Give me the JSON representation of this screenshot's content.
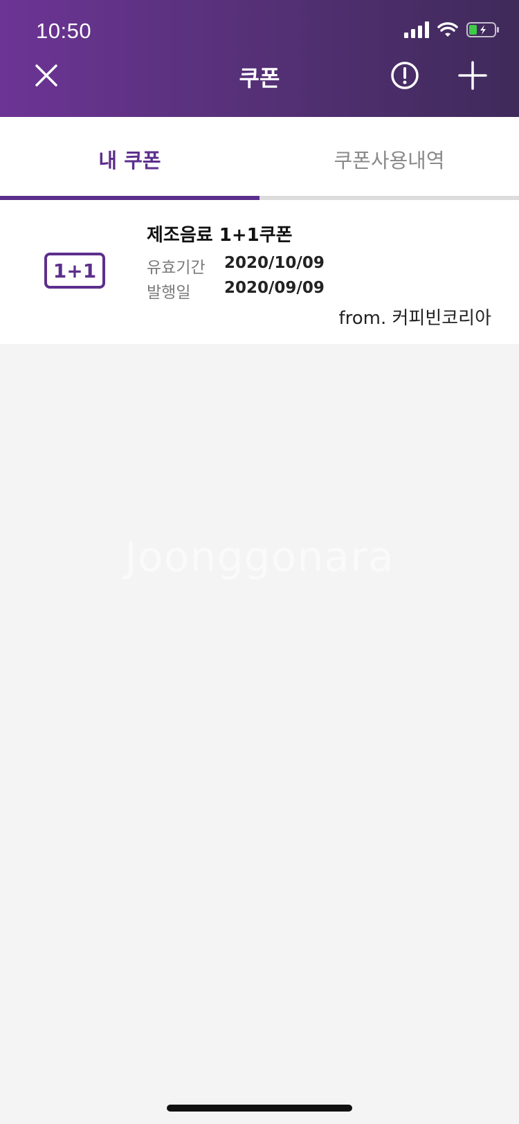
{
  "status_bar": {
    "time": "10:50"
  },
  "nav": {
    "title": "쿠폰"
  },
  "tabs": [
    {
      "label": "내 쿠폰"
    },
    {
      "label": "쿠폰사용내역"
    }
  ],
  "coupons": [
    {
      "badge": "1+1",
      "title": "제조음료 1+1쿠폰",
      "expire_label": "유효기간",
      "expire_value": "2020/10/09",
      "issue_label": "발행일",
      "issue_value": "2020/09/09",
      "from": "from. 커피빈코리아"
    }
  ],
  "watermark": "Joonggonara",
  "icons": {
    "close": "close-icon",
    "info": "info-icon",
    "add": "plus-icon",
    "signal": "signal-icon",
    "wifi": "wifi-icon",
    "battery": "battery-icon"
  },
  "colors": {
    "accent": "#5c2f8c",
    "header_start": "#6c3495",
    "header_end": "#3f2a5a",
    "battery_fill": "#3fca4a"
  }
}
